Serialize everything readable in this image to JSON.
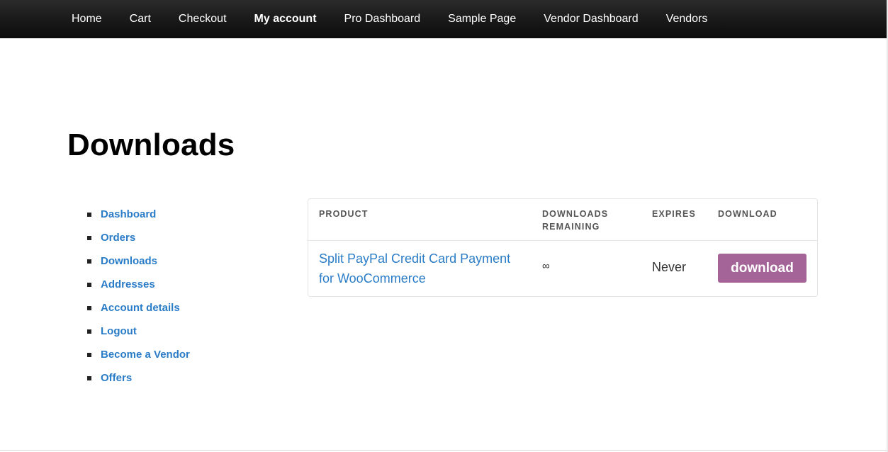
{
  "topnav": {
    "items": [
      {
        "label": "Home",
        "active": false
      },
      {
        "label": "Cart",
        "active": false
      },
      {
        "label": "Checkout",
        "active": false
      },
      {
        "label": "My account",
        "active": true
      },
      {
        "label": "Pro Dashboard",
        "active": false
      },
      {
        "label": "Sample Page",
        "active": false
      },
      {
        "label": "Vendor Dashboard",
        "active": false
      },
      {
        "label": "Vendors",
        "active": false
      }
    ]
  },
  "page": {
    "title": "Downloads"
  },
  "account_nav": {
    "items": [
      {
        "label": "Dashboard"
      },
      {
        "label": "Orders"
      },
      {
        "label": "Downloads"
      },
      {
        "label": "Addresses"
      },
      {
        "label": "Account details"
      },
      {
        "label": "Logout"
      },
      {
        "label": "Become a Vendor"
      },
      {
        "label": "Offers"
      }
    ]
  },
  "downloads_table": {
    "columns": {
      "product": "PRODUCT",
      "remaining_line1": "DOWNLOADS",
      "remaining_line2": "REMAINING",
      "expires": "EXPIRES",
      "download": "DOWNLOAD"
    },
    "rows": [
      {
        "product_line1": "Split PayPal Credit Card Payment",
        "product_line2": "for WooCommerce",
        "remaining": "∞",
        "expires": "Never",
        "download_label": "download"
      }
    ]
  },
  "colors": {
    "nav_bg": "#111111",
    "link": "#2a7cc7",
    "button": "#a46497"
  }
}
